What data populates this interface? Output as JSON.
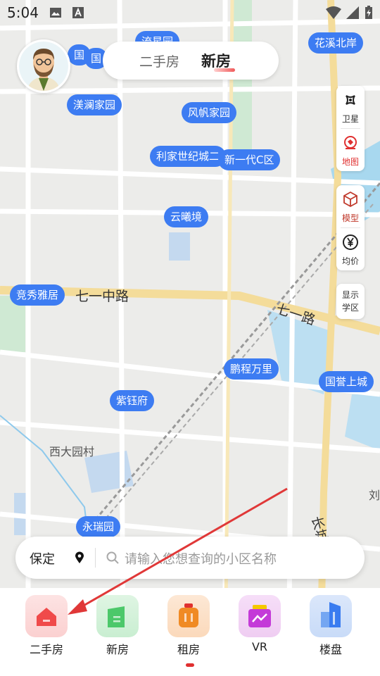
{
  "status_bar": {
    "time": "5:04"
  },
  "top_tabs": [
    {
      "label": "二手房",
      "active": false
    },
    {
      "label": "新房",
      "active": true
    }
  ],
  "side_tools": [
    {
      "label": "卫星",
      "icon": "satellite-icon"
    },
    {
      "label": "地图",
      "icon": "map-icon",
      "active": true
    },
    {
      "label": "模型",
      "icon": "cube-model-icon"
    },
    {
      "label": "均价",
      "icon": "yen-price-icon"
    }
  ],
  "school_toggle": {
    "line1": "显示",
    "line2": "学区"
  },
  "map": {
    "markers": [
      "流星园",
      "国",
      "国",
      "花溪北岸",
      "渼澜家园",
      "风帆家园",
      "利家世纪城二",
      "新一代C区",
      "云曦境",
      "竞秀雅居",
      "鹏程万里",
      "国誉上城",
      "紫钰府",
      "永瑞园"
    ],
    "roads": [
      "七一中路",
      "七一路",
      "长城"
    ],
    "places": [
      "西大园村",
      "刘"
    ]
  },
  "search": {
    "city": "保定",
    "placeholder": "请输入您想查询的小区名称"
  },
  "nav_items": [
    {
      "label": "二手房",
      "icon": "house-icon",
      "color": "#f04a4a"
    },
    {
      "label": "新房",
      "icon": "building-icon",
      "color": "#4cc86a"
    },
    {
      "label": "租房",
      "icon": "rent-bag-icon",
      "color": "#f08a24"
    },
    {
      "label": "VR",
      "icon": "vr-icon",
      "color": "#c43ad8"
    },
    {
      "label": "楼盘",
      "icon": "tower-icon",
      "color": "#3a7cf0"
    }
  ],
  "colors": {
    "marker": "#3d7cf2",
    "accent": "#e03030"
  }
}
